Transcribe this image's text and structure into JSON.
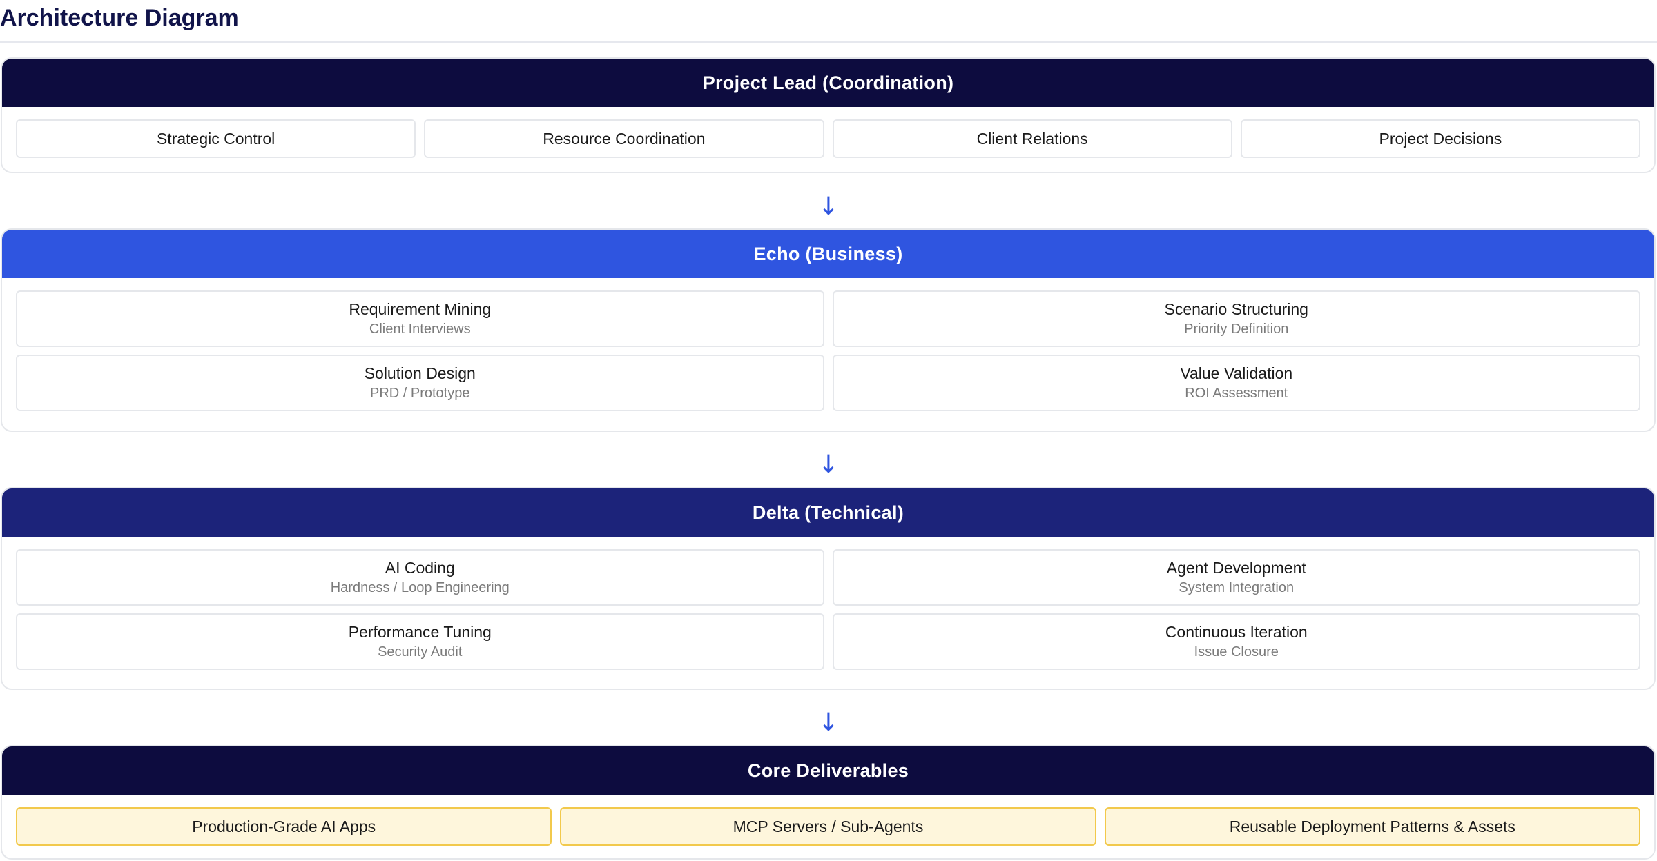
{
  "page": {
    "title": "Architecture Diagram"
  },
  "colors": {
    "title": "#11144a",
    "layer_coordination": "#0d0c3f",
    "layer_business": "#2f55e0",
    "layer_technical": "#1c237a",
    "layer_deliverables": "#0d0c3f",
    "deliverable_fill": "#fef6dc",
    "deliverable_border": "#f2c94c",
    "arrow": "#2f55e0"
  },
  "arrow_glyph": "↓",
  "layers": {
    "coordination": {
      "title": "Project Lead (Coordination)",
      "items": [
        "Strategic Control",
        "Resource Coordination",
        "Client Relations",
        "Project Decisions"
      ]
    },
    "business": {
      "title": "Echo (Business)",
      "items": [
        {
          "title": "Requirement Mining",
          "subtitle": "Client Interviews"
        },
        {
          "title": "Scenario Structuring",
          "subtitle": "Priority Definition"
        },
        {
          "title": "Solution Design",
          "subtitle": "PRD / Prototype"
        },
        {
          "title": "Value Validation",
          "subtitle": "ROI Assessment"
        }
      ]
    },
    "technical": {
      "title": "Delta (Technical)",
      "items": [
        {
          "title": "AI Coding",
          "subtitle": "Hardness / Loop Engineering"
        },
        {
          "title": "Agent Development",
          "subtitle": "System Integration"
        },
        {
          "title": "Performance Tuning",
          "subtitle": "Security Audit"
        },
        {
          "title": "Continuous Iteration",
          "subtitle": "Issue Closure"
        }
      ]
    },
    "deliverables": {
      "title": "Core Deliverables",
      "items": [
        "Production-Grade AI Apps",
        "MCP Servers / Sub-Agents",
        "Reusable Deployment Patterns & Assets"
      ]
    }
  }
}
